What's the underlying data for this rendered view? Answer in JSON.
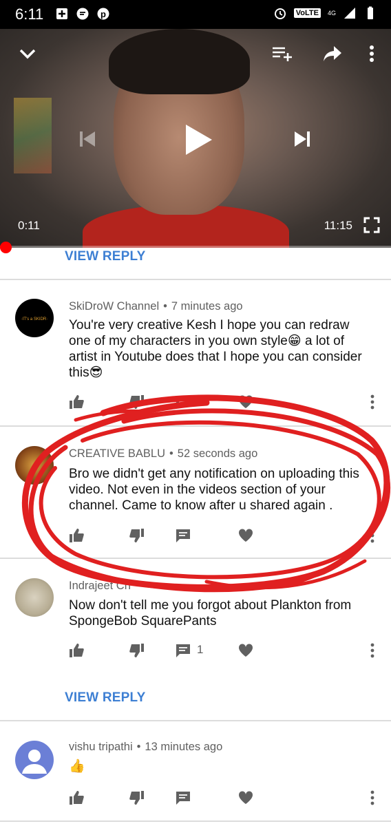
{
  "status_bar": {
    "time": "6:11",
    "volte": "VoLTE",
    "network": "4G"
  },
  "player": {
    "current_time": "0:11",
    "total_time": "11:15",
    "progress_fraction": 0.016,
    "progress_color": "#ff0000"
  },
  "top_reply_link": "VIEW REPLY",
  "comments": [
    {
      "author": "SkiDroW Channel",
      "dot": "•",
      "time": "7 minutes ago",
      "text": "You're very creative Kesh I hope you can redraw one of my characters in you own style😁 a lot of artist in Youtube does that I hope you can consider this😎"
    },
    {
      "author": "CREATIVE BABLU",
      "dot": "•",
      "time": "52 seconds ago",
      "text": "Bro we didn't get any notification on uploading this video. Not even in the videos section of your channel. Came to know after u shared again ."
    },
    {
      "author": "Indrajeet Ch",
      "dot": "",
      "time": "",
      "text": "Now don't tell me you forgot about Plankton from SpongeBob SquarePants",
      "reply_count": "1",
      "reply_link": "VIEW REPLY"
    },
    {
      "author": "vishu tripathi",
      "dot": "•",
      "time": "13 minutes ago",
      "text": "👍"
    }
  ],
  "colors": {
    "link": "#3d7fd3",
    "annotation": "#e02020",
    "icon": "#606060"
  },
  "icons": [
    "chevron-down-icon",
    "add-to-queue-icon",
    "share-icon",
    "more-vert-icon",
    "skip-previous-icon",
    "play-icon",
    "skip-next-icon",
    "fullscreen-icon",
    "thumb-up-icon",
    "thumb-down-icon",
    "reply-icon",
    "heart-icon"
  ]
}
